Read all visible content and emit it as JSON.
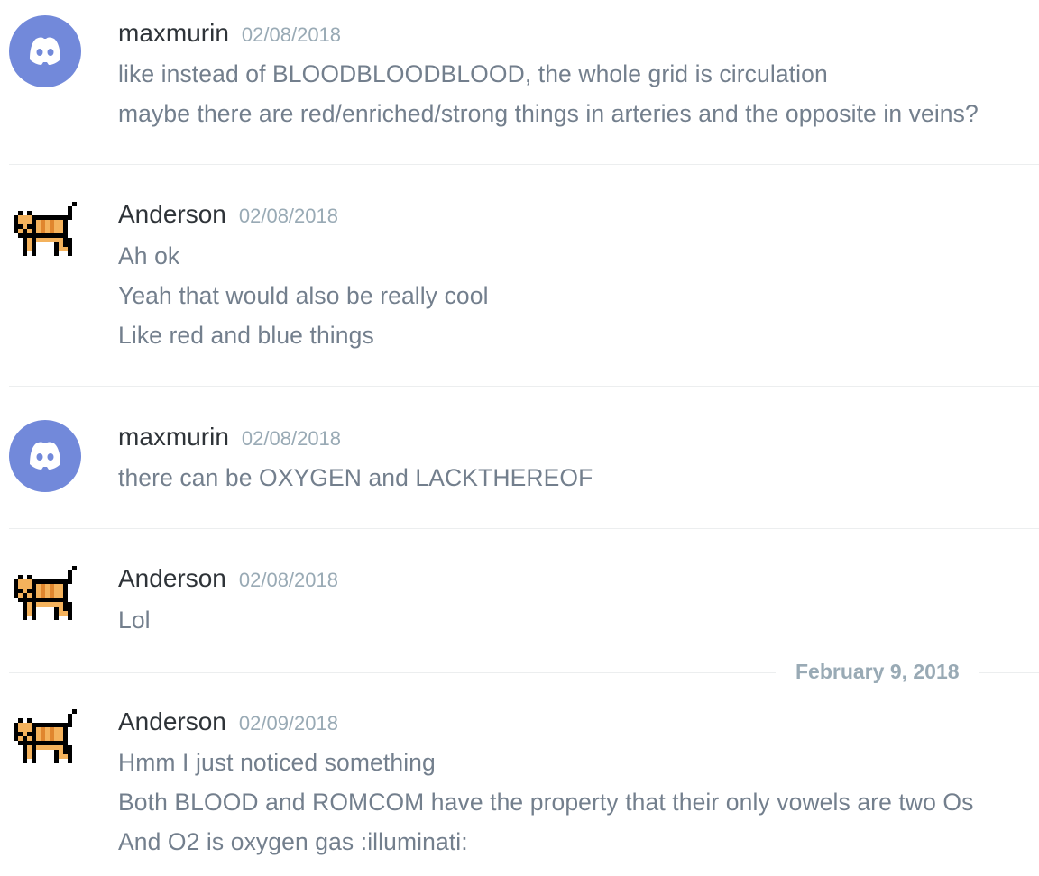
{
  "messages": [
    {
      "author": "maxmurin",
      "avatar": "discord-logo-icon",
      "timestamp": "02/08/2018",
      "lines": [
        "like instead of BLOODBLOODBLOOD, the whole grid is circulation",
        "maybe there are red/enriched/strong things in arteries and the opposite in veins?"
      ]
    },
    {
      "author": "Anderson",
      "avatar": "pixel-cat-icon",
      "timestamp": "02/08/2018",
      "lines": [
        "Ah ok",
        "Yeah that would also be really cool",
        "Like red and blue things"
      ]
    },
    {
      "author": "maxmurin",
      "avatar": "discord-logo-icon",
      "timestamp": "02/08/2018",
      "lines": [
        "there can be OXYGEN and LACKTHEREOF"
      ]
    },
    {
      "author": "Anderson",
      "avatar": "pixel-cat-icon",
      "timestamp": "02/08/2018",
      "lines": [
        "Lol"
      ]
    },
    {
      "author": "Anderson",
      "avatar": "pixel-cat-icon",
      "timestamp": "02/09/2018",
      "lines": [
        "Hmm I just noticed something",
        "Both BLOOD and ROMCOM have the property that their only vowels are two Os",
        "And O2 is oxygen gas :illuminati:"
      ]
    }
  ],
  "date_divider": "February 9, 2018",
  "colors": {
    "discord_blurple": "#7289da",
    "username": "#2e3338",
    "timestamp": "#99aab5",
    "message_text": "#737f8d",
    "divider": "#eceeef",
    "cat_orange": "#f4b25c",
    "cat_stripe": "#e0862e"
  }
}
